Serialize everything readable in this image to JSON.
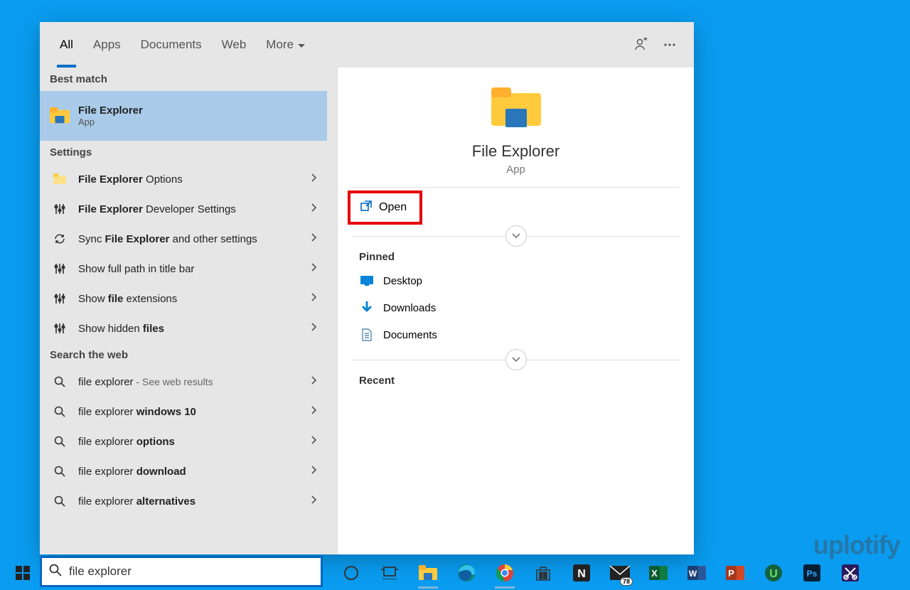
{
  "tabs": [
    "All",
    "Apps",
    "Documents",
    "Web",
    "More"
  ],
  "active_tab": 0,
  "sections": {
    "best_match": "Best match",
    "settings": "Settings",
    "web": "Search the web"
  },
  "best_match_item": {
    "title": "File Explorer",
    "subtitle": "App"
  },
  "settings_items": [
    {
      "pre": "",
      "bold": "File Explorer",
      "post": " Options",
      "icon": "folder-small"
    },
    {
      "pre": "",
      "bold": "File Explorer",
      "post": " Developer Settings",
      "icon": "sliders"
    },
    {
      "pre": "Sync ",
      "bold": "File Explorer",
      "post": " and other settings",
      "icon": "sync"
    },
    {
      "pre": "Show full path in title bar",
      "bold": "",
      "post": "",
      "icon": "sliders"
    },
    {
      "pre": "Show ",
      "bold": "file",
      "post": " extensions",
      "icon": "sliders"
    },
    {
      "pre": "Show hidden ",
      "bold": "files",
      "post": "",
      "icon": "sliders"
    }
  ],
  "web_items": [
    {
      "pre": "file explorer",
      "bold": "",
      "hint": " - See web results"
    },
    {
      "pre": "file explorer ",
      "bold": "windows 10",
      "hint": ""
    },
    {
      "pre": "file explorer ",
      "bold": "options",
      "hint": ""
    },
    {
      "pre": "file explorer ",
      "bold": "download",
      "hint": ""
    },
    {
      "pre": "file explorer ",
      "bold": "alternatives",
      "hint": ""
    }
  ],
  "preview": {
    "title": "File Explorer",
    "type": "App",
    "open_label": "Open",
    "pinned_label": "Pinned",
    "recent_label": "Recent",
    "pinned_items": [
      {
        "label": "Desktop",
        "icon": "desktop"
      },
      {
        "label": "Downloads",
        "icon": "download"
      },
      {
        "label": "Documents",
        "icon": "document"
      }
    ]
  },
  "search_value": "file explorer",
  "taskbar": {
    "mail_badge": "78",
    "apps": [
      "cortana",
      "taskview",
      "explorer",
      "edge",
      "chrome",
      "store",
      "notion",
      "mail",
      "excel",
      "word",
      "powerpoint",
      "u",
      "photoshop",
      "snip"
    ]
  },
  "watermark": "uplotify"
}
